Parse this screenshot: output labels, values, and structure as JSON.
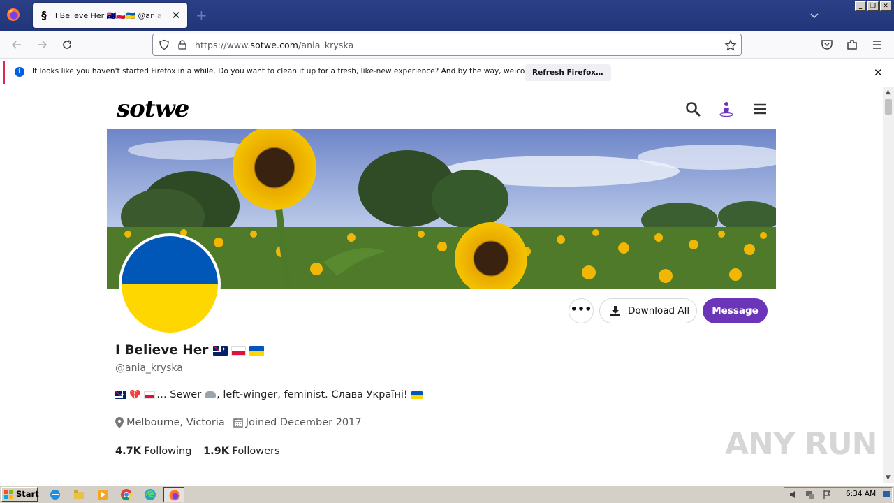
{
  "browser": {
    "tab": {
      "title": "I Believe Her 🇦🇺🇵🇱🇺🇦 @ania_kryska",
      "close_label": "✕"
    },
    "new_tab_label": "+",
    "url": {
      "prefix": "https://www.",
      "host": "sotwe.com",
      "path": "/ania_kryska"
    },
    "notification": {
      "text": "It looks like you haven't started Firefox in a while. Do you want to clean it up for a fresh, like-new experience? And by the way, welcome back!",
      "button_label": "Refresh Firefox…",
      "close_label": "✕"
    }
  },
  "site": {
    "logo": "sotwe"
  },
  "profile": {
    "name": "I Believe Her",
    "handle": "@ania_kryska",
    "bio_text": "… Sewer",
    "bio_text2": ", left-winger, feminist. Слава Україні!",
    "location": "Melbourne, Victoria",
    "joined": "Joined December 2017",
    "following_count": "4.7K",
    "following_label": "Following",
    "followers_count": "1.9K",
    "followers_label": "Followers",
    "more_label": "•••",
    "download_label": "Download All",
    "message_label": "Message",
    "colors": {
      "accent": "#6a35b8",
      "flag_blue": "#0057b8",
      "flag_yellow": "#ffd700"
    }
  },
  "watermark": "ANY RUN",
  "taskbar": {
    "start_label": "Start",
    "clock": "6:34 AM"
  }
}
